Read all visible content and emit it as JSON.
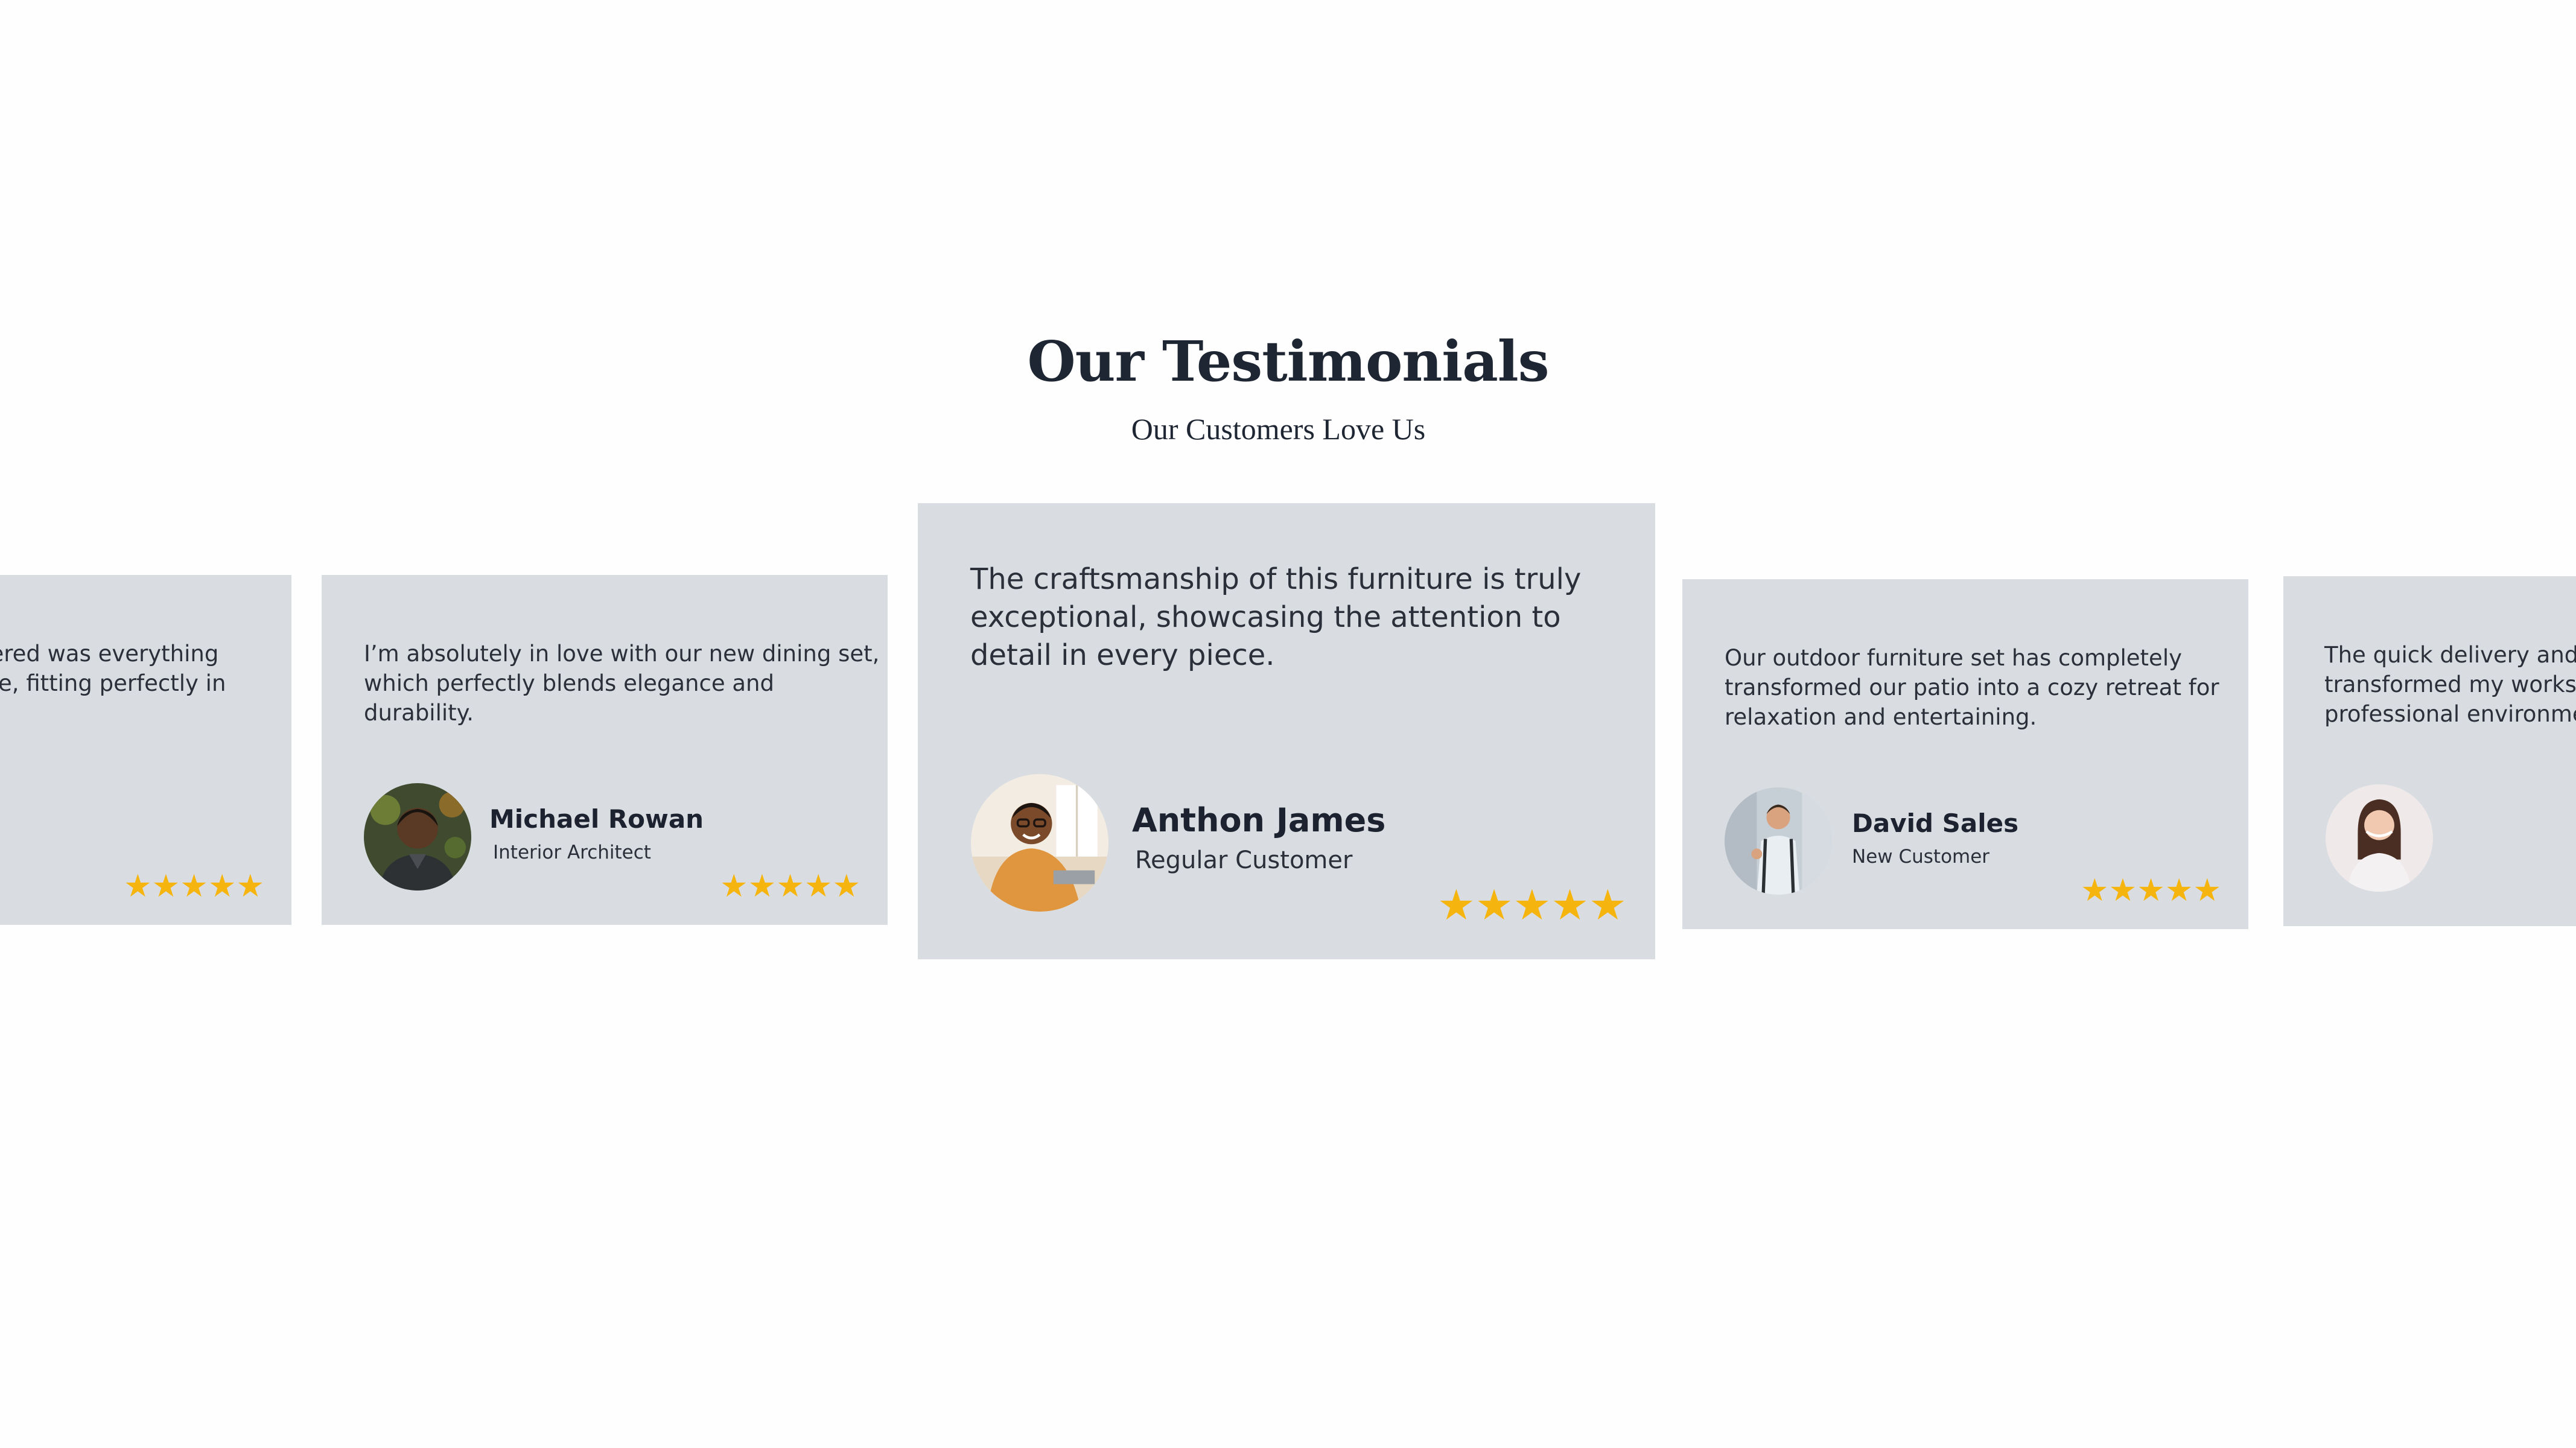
{
  "header": {
    "title": "Our Testimonials",
    "subtitle": "Our Customers Love Us"
  },
  "theme": {
    "card_background": "#d9dde1",
    "star_color": "#f6b40e",
    "heading_color": "#1f2633"
  },
  "testimonials": [
    {
      "quote_lines": [
        "dered was everything",
        "ore, fitting perfectly in"
      ],
      "rating": 5,
      "rating_display": "★★★★★"
    },
    {
      "quote_lines": [
        "I’m absolutely in love with our new dining set,",
        "which perfectly blends elegance and",
        "durability."
      ],
      "name": "Michael Rowan",
      "role": "Interior Architect",
      "avatar_icon": "avatar-michael-rowan",
      "rating": 5,
      "rating_display": "★★★★★"
    },
    {
      "quote_lines": [
        "The craftsmanship of this furniture is truly",
        "exceptional, showcasing the attention to",
        "detail in every piece."
      ],
      "name": "Anthon James",
      "role": "Regular Customer",
      "avatar_icon": "avatar-anthon-james",
      "rating": 5,
      "rating_display": "★★★★★"
    },
    {
      "quote_lines": [
        "Our outdoor furniture set has completely",
        "transformed our patio into a cozy retreat for",
        "relaxation and entertaining."
      ],
      "name": "David Sales",
      "role": "New Customer",
      "avatar_icon": "avatar-david-sales",
      "rating": 5,
      "rating_display": "★★★★★"
    },
    {
      "quote_lines": [
        "The quick delivery and b",
        "transformed my worksp",
        "professional environme"
      ],
      "avatar_icon": "avatar-customer-5"
    }
  ]
}
